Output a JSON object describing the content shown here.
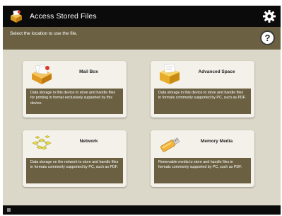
{
  "titlebar": {
    "title": "Access Stored Files",
    "app_icon": "folder-box-icon",
    "settings_icon": "gear-icon"
  },
  "subheader": {
    "instruction": "Select the location to use the file.",
    "help_label": "?"
  },
  "cards": [
    {
      "id": "mailbox",
      "title": "Mail Box",
      "icon": "mailbox-icon",
      "description": "Data storage in this device to store and handle files for printing in format exclusively supported by this device."
    },
    {
      "id": "advanced",
      "title": "Advanced Space",
      "icon": "advanced-space-icon",
      "description": "Data storage in this device to store and handle files in formats commonly supported by PC, such as PDF."
    },
    {
      "id": "network",
      "title": "Network",
      "icon": "network-icon",
      "description": "Data storage on the network to store and handle files in formats commonly supported by PC, such as PDF."
    },
    {
      "id": "memory",
      "title": "Memory Media",
      "icon": "usb-memory-icon",
      "description": "Removable media to store and handle files in formats commonly supported by PC, such as PDF."
    }
  ],
  "colors": {
    "titlebar": "#0b0b0b",
    "subheader": "#6b6142",
    "content_bg": "#dcd8c9",
    "card_bg": "#f3f1ea",
    "desc_bg": "#6b6142"
  }
}
